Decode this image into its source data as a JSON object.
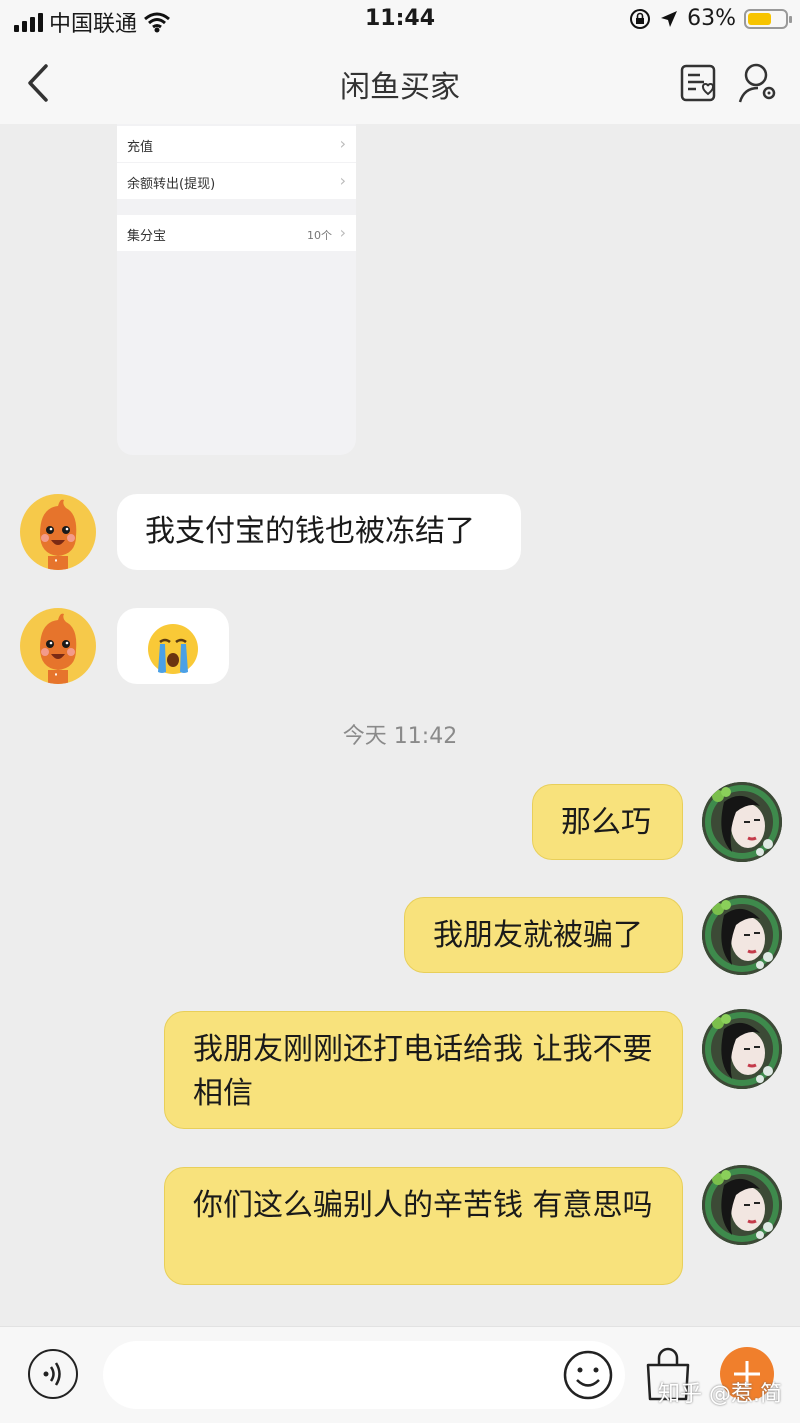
{
  "status_bar": {
    "carrier": "中国联通",
    "time": "11:44",
    "battery_percent": "63%",
    "battery_level": 0.63,
    "icons": [
      "signal-icon",
      "wifi-icon",
      "orientation-lock-icon",
      "location-icon",
      "battery-icon"
    ]
  },
  "nav": {
    "title": "闲鱼买家",
    "back_icon": "chevron-left-icon",
    "right_icons": [
      "order-note-icon",
      "user-settings-icon"
    ]
  },
  "screenshot_card": {
    "rows": [
      {
        "label": "充值",
        "count": ""
      },
      {
        "label": "余额转出(提现)",
        "count": ""
      },
      {
        "label": "集分宝",
        "count": "10个"
      }
    ]
  },
  "messages": [
    {
      "from": "seller",
      "text": "我支付宝的钱也被冻结了"
    },
    {
      "from": "seller",
      "text": "😭"
    },
    {
      "from": "me",
      "text": "那么巧"
    },
    {
      "from": "me",
      "text": "我朋友就被骗了"
    },
    {
      "from": "me",
      "text": "我朋友刚刚还打电话给我 让我不要相信"
    },
    {
      "from": "me",
      "text": "你们这么骗别人的辛苦钱 有意思吗"
    }
  ],
  "timestamp": "今天 11:42",
  "input_bar": {
    "placeholder": "",
    "icons": [
      "voice-icon",
      "emoji-icon",
      "bag-icon",
      "plus-icon"
    ]
  },
  "watermark": "知乎 @惹.简",
  "colors": {
    "background": "#ededed",
    "outgoing_bubble": "#f8e27c",
    "incoming_bubble": "#ffffff",
    "accent_orange": "#f07f2c",
    "battery_fill": "#f7c400"
  }
}
